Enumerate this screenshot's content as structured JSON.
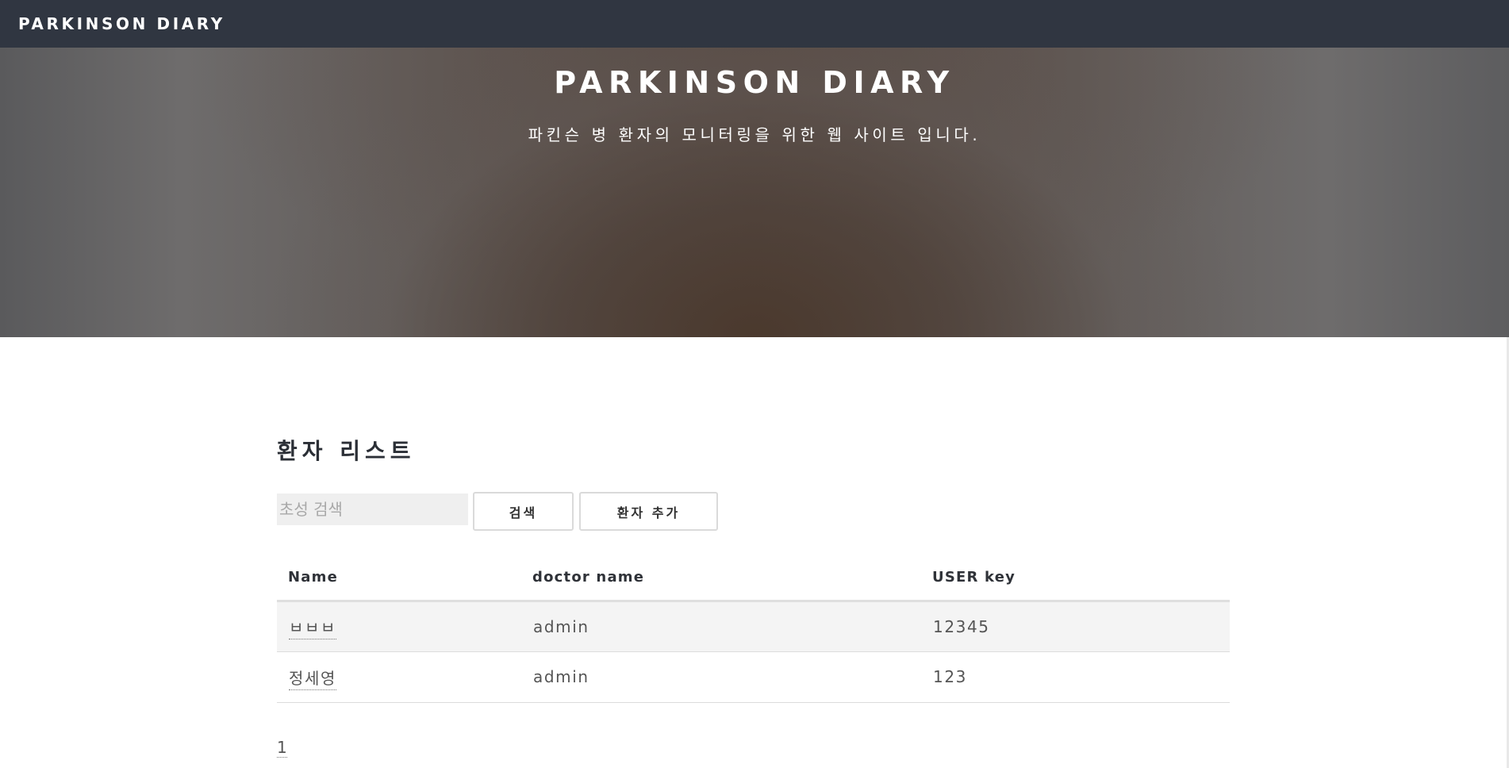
{
  "header": {
    "brand": "PARKINSON DIARY"
  },
  "hero": {
    "title": "PARKINSON DIARY",
    "subtitle": "파킨슨 병 환자의 모니터링을 위한 웹 사이트 입니다."
  },
  "main": {
    "section_title": "환자 리스트",
    "search": {
      "placeholder": "초성 검색",
      "value": ""
    },
    "buttons": {
      "search_label": "검색",
      "add_label": "환자 추가"
    },
    "table": {
      "columns": [
        "Name",
        "doctor name",
        "USER key"
      ],
      "rows": [
        {
          "name": "ㅂㅂㅂ",
          "doctor": "admin",
          "key": "12345"
        },
        {
          "name": "정세영",
          "doctor": "admin",
          "key": "123"
        }
      ]
    },
    "pagination": {
      "current": "1"
    }
  }
}
